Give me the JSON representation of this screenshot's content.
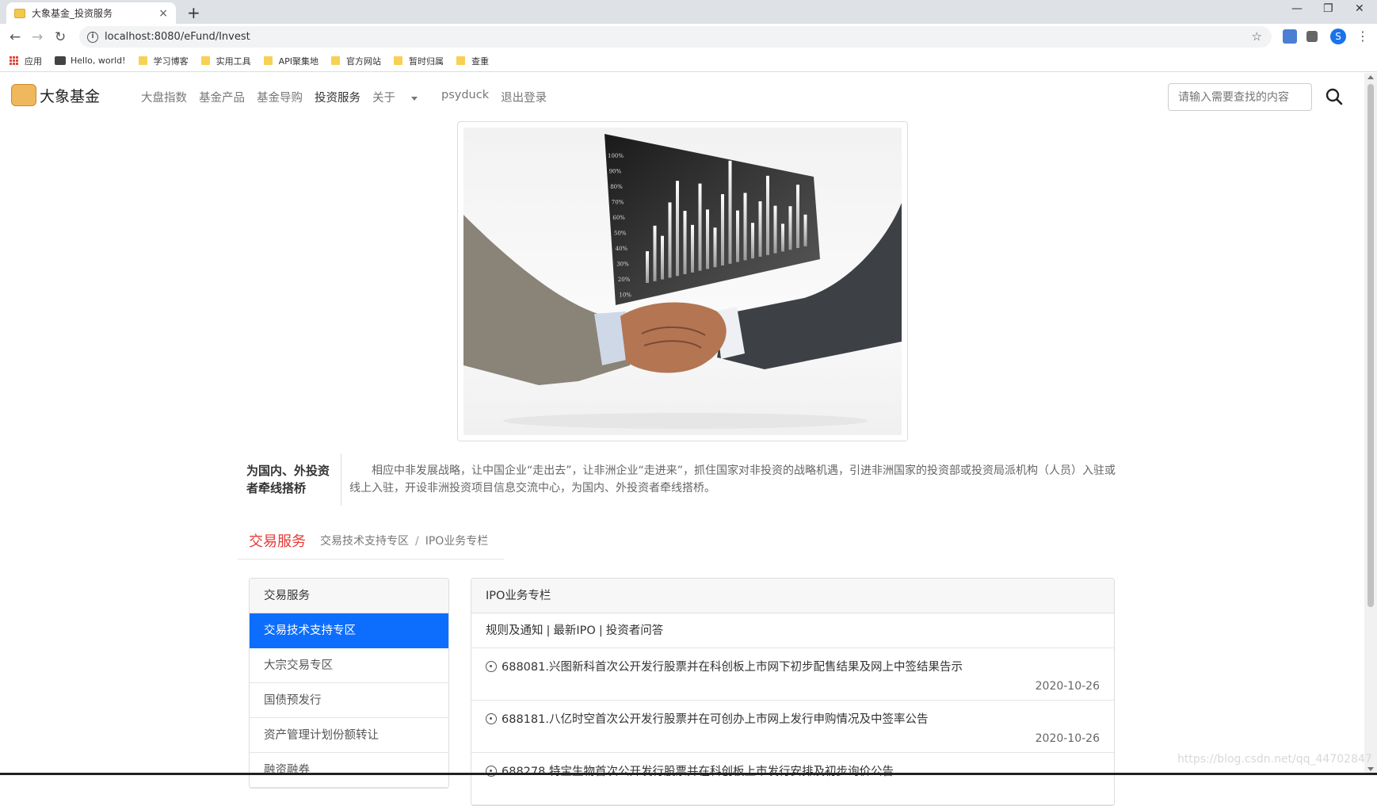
{
  "browser": {
    "tab_title": "大象基金_投资服务",
    "url": "localhost:8080/eFund/Invest",
    "new_tab_symbol": "+",
    "close_symbol": "×",
    "profile_initial": "S",
    "bookmarks": [
      "应用",
      "Hello, world!",
      "学习博客",
      "实用工具",
      "API聚集地",
      "官方网站",
      "暂时归属",
      "查重"
    ]
  },
  "site": {
    "logo_text": "大象基金",
    "nav": [
      "大盘指数",
      "基金产品",
      "基金导购",
      "投资服务",
      "关于",
      "psyduck",
      "退出登录"
    ],
    "search_placeholder": "请输入需要查找的内容"
  },
  "hero": {
    "chart_ticks": [
      "100%",
      "90%",
      "80%",
      "70%",
      "60%",
      "50%",
      "40%",
      "30%",
      "20%",
      "10%"
    ]
  },
  "intro": {
    "title": "为国内、外投资者牵线搭桥",
    "text": "相应中非发展战略，让中国企业“走出去”，让非洲企业“走进来”，抓住国家对非投资的战略机遇，引进非洲国家的投资部或投资局派机构（人员）入驻或线上入驻，开设非洲投资项目信息交流中心，为国内、外投资者牵线搭桥。"
  },
  "section": {
    "title": "交易服务",
    "breadcrumb": [
      "交易技术支持专区",
      "IPO业务专栏"
    ],
    "breadcrumb_sep": "/"
  },
  "left_menu": {
    "header": "交易服务",
    "items": [
      "交易技术支持专区",
      "大宗交易专区",
      "国债预发行",
      "资产管理计划份额转让",
      "融资融券"
    ]
  },
  "right_panel": {
    "header": "IPO业务专栏",
    "tabs": [
      "规则及通知",
      "最新IPO",
      "投资者问答"
    ],
    "tab_sep": "|",
    "news": [
      {
        "title": "688081.兴图新科首次公开发行股票并在科创板上市网下初步配售结果及网上中签结果告示",
        "date": "2020-10-26"
      },
      {
        "title": "688181.八亿时空首次公开发行股票并在可创办上市网上发行申购情况及中签率公告",
        "date": "2020-10-26"
      },
      {
        "title": "688278.特宝生物首次公开发行股票并在科创板上市发行安排及初步询价公告",
        "date": ""
      }
    ]
  },
  "watermark": "https://blog.csdn.net/qq_44702847",
  "colors": {
    "accent_blue": "#0d6efd",
    "section_red": "#e53935"
  }
}
